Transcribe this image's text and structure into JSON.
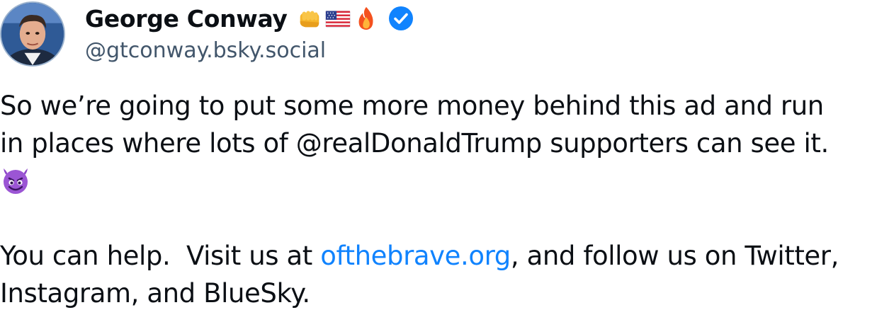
{
  "author": {
    "display_name": "George Conway",
    "handle": "@gtconway.bsky.social",
    "name_emojis": [
      "fist-emoji",
      "us-flag-emoji",
      "fire-emoji"
    ],
    "verified": true,
    "avatar_icon": "avatar"
  },
  "post": {
    "line1": "So we’re going to put some more money behind this ad and run",
    "line2": "in places where lots of @realDonaldTrump supporters can see it.",
    "line3_emoji": "smiling-devil-emoji",
    "line4_prefix": "You can help.  Visit us at ",
    "line4_link": "ofthebrave.org",
    "line4_suffix": ", and follow us on Twitter,",
    "line5": "Instagram, and BlueSky."
  },
  "colors": {
    "link": "#1083fe",
    "handle": "#42566b",
    "verified": "#1083fe",
    "text": "#0b0f14"
  }
}
